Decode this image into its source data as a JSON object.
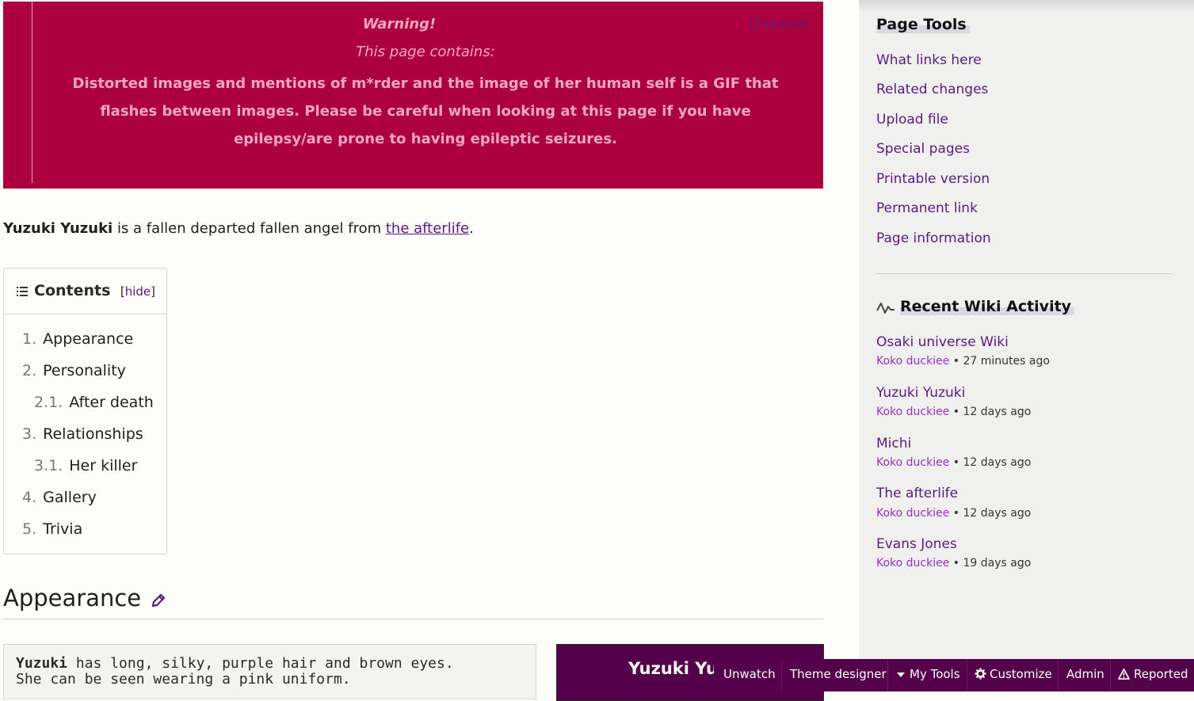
{
  "warning": {
    "title": "Warning!",
    "expand": "[Expand]",
    "subtitle": "This page contains:",
    "body": "Distorted images and mentions of m*rder and the image of her human self is a GIF that flashes between images. Please be careful when looking at this page if you have epilepsy/are prone to having epileptic seizures."
  },
  "intro": {
    "name": "Yuzuki Yuzuki",
    "text": " is a fallen departed fallen angel from ",
    "link": "the afterlife",
    "end": "."
  },
  "toc": {
    "title": "Contents",
    "hide_open": "[",
    "hide": "hide",
    "hide_close": "]",
    "items": [
      {
        "num": "1.",
        "label": "Appearance"
      },
      {
        "num": "2.",
        "label": "Personality"
      },
      {
        "num": "2.1.",
        "label": "After death"
      },
      {
        "num": "3.",
        "label": "Relationships"
      },
      {
        "num": "3.1.",
        "label": "Her killer"
      },
      {
        "num": "4.",
        "label": "Gallery"
      },
      {
        "num": "5.",
        "label": "Trivia"
      }
    ]
  },
  "section": {
    "heading": "Appearance",
    "code_name": "Yuzuki",
    "code_line1": " has long, silky, purple hair and brown eyes.",
    "code_line2": "She can be seen wearing a pink uniform.",
    "infobox_title": "Yuzuki Yuzuki"
  },
  "rail": {
    "page_tools_title": "Page Tools",
    "tools": [
      "What links here",
      "Related changes",
      "Upload file",
      "Special pages",
      "Printable version",
      "Permanent link",
      "Page information"
    ],
    "activity_title": "Recent Wiki Activity",
    "activity": [
      {
        "title": "Osaki universe Wiki",
        "user": "Koko duckiee",
        "time": " • 27 minutes ago"
      },
      {
        "title": "Yuzuki Yuzuki",
        "user": "Koko duckiee",
        "time": " • 12 days ago"
      },
      {
        "title": "Michi",
        "user": "Koko duckiee",
        "time": " • 12 days ago"
      },
      {
        "title": "The afterlife",
        "user": "Koko duckiee",
        "time": " • 12 days ago"
      },
      {
        "title": "Evans Jones",
        "user": "Koko duckiee",
        "time": " • 19 days ago"
      }
    ]
  },
  "toolbar": {
    "unwatch": "Unwatch",
    "theme_designer": "Theme designer",
    "my_tools": "My Tools",
    "customize": "Customize",
    "admin": "Admin",
    "reported": "Reported"
  },
  "colors": {
    "warning_bg": "#ad003f",
    "warning_text": "#f5a6c0",
    "link": "#5a1a82",
    "toolbar_bg": "#54004a"
  }
}
